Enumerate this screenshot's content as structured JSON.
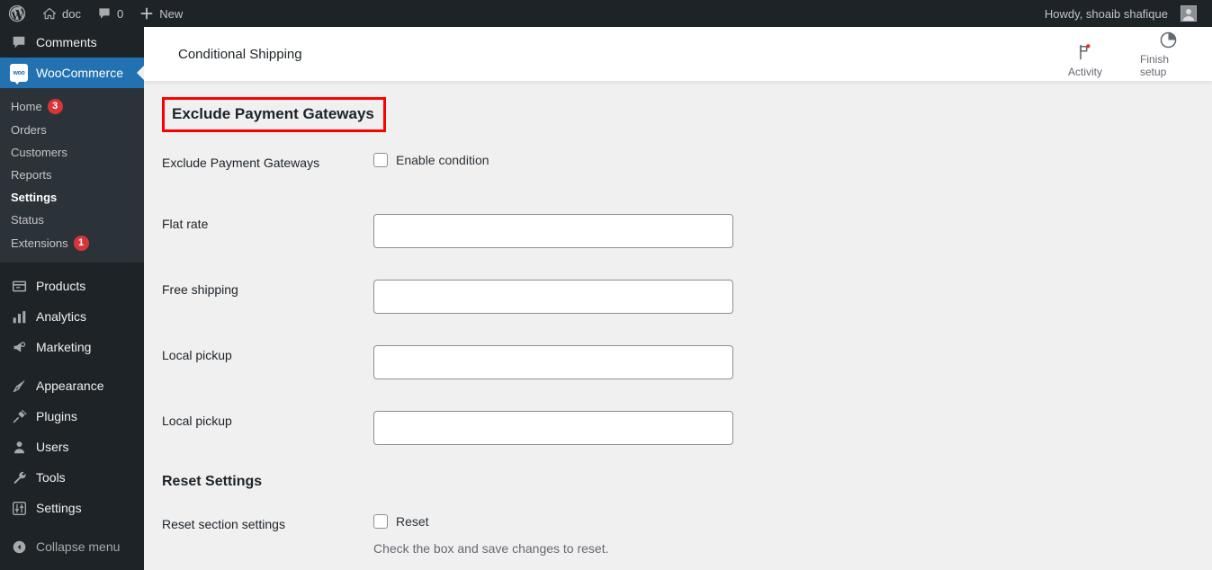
{
  "adminbar": {
    "wp_logo": "wordpress-logo",
    "site_name": "doc",
    "comments_count": "0",
    "new_label": "New",
    "greeting": "Howdy, shoaib shafique"
  },
  "sidebar": {
    "comments_label": "Comments",
    "woocommerce_label": "WooCommerce",
    "submenu": [
      {
        "label": "Home",
        "badge": "3",
        "active": false
      },
      {
        "label": "Orders",
        "badge": "",
        "active": false
      },
      {
        "label": "Customers",
        "badge": "",
        "active": false
      },
      {
        "label": "Reports",
        "badge": "",
        "active": false
      },
      {
        "label": "Settings",
        "badge": "",
        "active": true
      },
      {
        "label": "Status",
        "badge": "",
        "active": false
      },
      {
        "label": "Extensions",
        "badge": "1",
        "active": false
      }
    ],
    "items": [
      {
        "label": "Products",
        "icon": "products-icon"
      },
      {
        "label": "Analytics",
        "icon": "analytics-icon"
      },
      {
        "label": "Marketing",
        "icon": "marketing-icon"
      },
      {
        "label": "Appearance",
        "icon": "appearance-icon"
      },
      {
        "label": "Plugins",
        "icon": "plugins-icon"
      },
      {
        "label": "Users",
        "icon": "users-icon"
      },
      {
        "label": "Tools",
        "icon": "tools-icon"
      },
      {
        "label": "Settings",
        "icon": "settings-icon"
      }
    ],
    "collapse_label": "Collapse menu"
  },
  "header": {
    "title": "Conditional Shipping",
    "actions": [
      {
        "label": "Activity",
        "icon": "flag-icon"
      },
      {
        "label": "Finish setup",
        "icon": "progress-circle-icon"
      }
    ]
  },
  "sections": {
    "exclude": {
      "heading": "Exclude Payment Gateways",
      "rows": [
        {
          "label": "Exclude Payment Gateways",
          "type": "checkbox",
          "checkbox_label": "Enable condition",
          "checked": false
        },
        {
          "label": "Flat rate",
          "type": "text",
          "value": ""
        },
        {
          "label": "Free shipping",
          "type": "text",
          "value": ""
        },
        {
          "label": "Local pickup",
          "type": "text",
          "value": ""
        },
        {
          "label": "Local pickup",
          "type": "text",
          "value": ""
        }
      ]
    },
    "reset": {
      "heading": "Reset Settings",
      "row_label": "Reset section settings",
      "checkbox_label": "Reset",
      "checked": false,
      "help": "Check the box and save changes to reset."
    }
  },
  "colors": {
    "sidebar_bg": "#1d2327",
    "submenu_bg": "#2c3338",
    "accent_blue": "#2271b1",
    "badge_red": "#d63638",
    "annotation_red": "#ff0000",
    "content_bg": "#f0f0f1"
  }
}
